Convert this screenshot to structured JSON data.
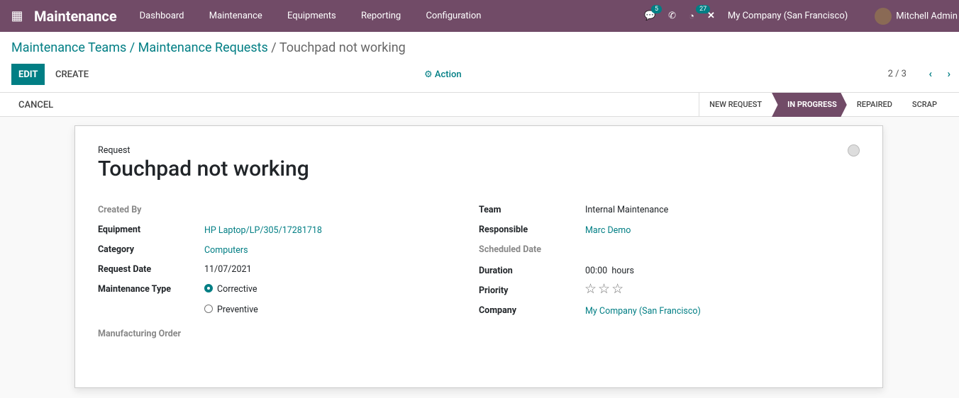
{
  "nav": {
    "brand": "Maintenance",
    "menu": [
      "Dashboard",
      "Maintenance",
      "Equipments",
      "Reporting",
      "Configuration"
    ],
    "messages_count": "5",
    "activities_count": "27",
    "company": "My Company (San Francisco)",
    "user": "Mitchell Admin"
  },
  "breadcrumb": {
    "items": [
      "Maintenance Teams",
      "Maintenance Requests"
    ],
    "current": "Touchpad not working"
  },
  "toolbar": {
    "edit": "EDIT",
    "create": "CREATE",
    "action": "Action",
    "pager": "2 / 3"
  },
  "statusbar": {
    "cancel": "CANCEL",
    "stages": [
      "NEW REQUEST",
      "IN PROGRESS",
      "REPAIRED",
      "SCRAP"
    ],
    "active": "IN PROGRESS"
  },
  "form": {
    "request_label": "Request",
    "title": "Touchpad not working",
    "left": {
      "created_by": "Created By",
      "equipment_label": "Equipment",
      "equipment": "HP Laptop/LP/305/17281718",
      "category_label": "Category",
      "category": "Computers",
      "request_date_label": "Request Date",
      "request_date": "11/07/2021",
      "mtype_label": "Maintenance Type",
      "mtype_options": [
        "Corrective",
        "Preventive"
      ],
      "mo_label": "Manufacturing Order"
    },
    "right": {
      "team_label": "Team",
      "team": "Internal Maintenance",
      "responsible_label": "Responsible",
      "responsible": "Marc Demo",
      "sched_label": "Scheduled Date",
      "duration_label": "Duration",
      "duration": "00:00",
      "duration_unit": "hours",
      "priority_label": "Priority",
      "priority": 0,
      "company_label": "Company",
      "company": "My Company (San Francisco)"
    }
  }
}
